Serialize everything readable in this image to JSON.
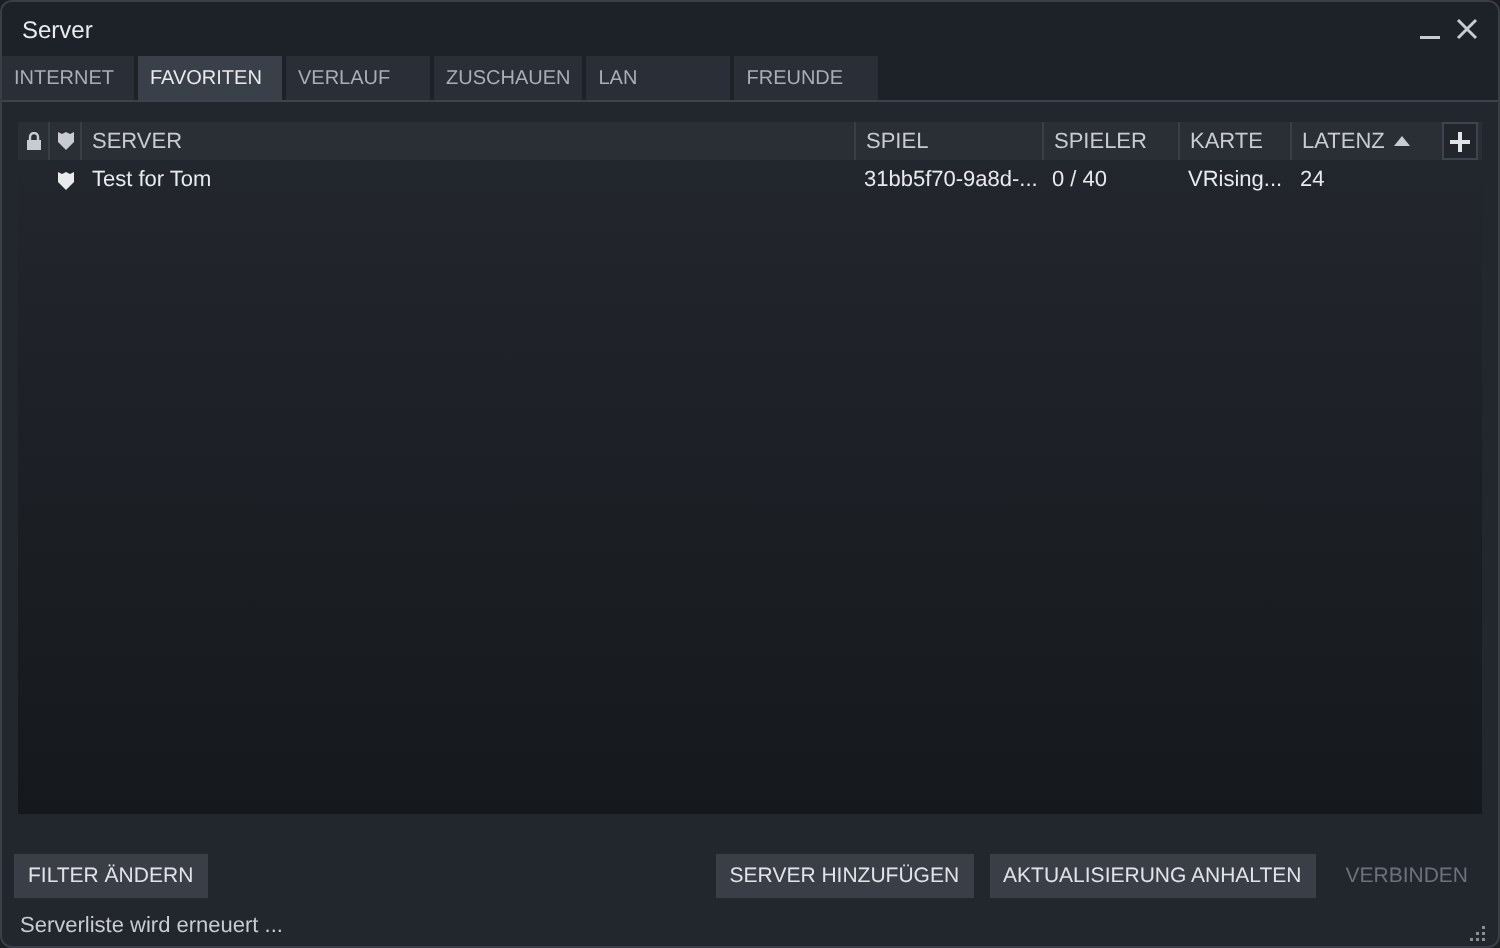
{
  "window": {
    "title": "Server"
  },
  "tabs": [
    {
      "label": "INTERNET",
      "selected": false
    },
    {
      "label": "FAVORITEN",
      "selected": true
    },
    {
      "label": "VERLAUF",
      "selected": false
    },
    {
      "label": "ZUSCHAUEN",
      "selected": false
    },
    {
      "label": "LAN",
      "selected": false
    },
    {
      "label": "FREUNDE",
      "selected": false
    }
  ],
  "table": {
    "columns": [
      "SERVER",
      "SPIEL",
      "SPIELER",
      "KARTE",
      "LATENZ"
    ],
    "rows": [
      {
        "cells": [
          "Test for Tom",
          "31bb5f70-9a8d-...",
          "0 / 40",
          "VRising...",
          "24"
        ]
      }
    ]
  },
  "buttons": [
    {
      "label": "FILTER ÄNDERN",
      "disabled": false
    },
    {
      "label": "SERVER HINZUFÜGEN",
      "disabled": false
    },
    {
      "label": "AKTUALISIERUNG ANHALTEN",
      "disabled": false
    },
    {
      "label": "VERBINDEN",
      "disabled": true
    }
  ],
  "status_bar": "Serverliste wird erneuert ..."
}
